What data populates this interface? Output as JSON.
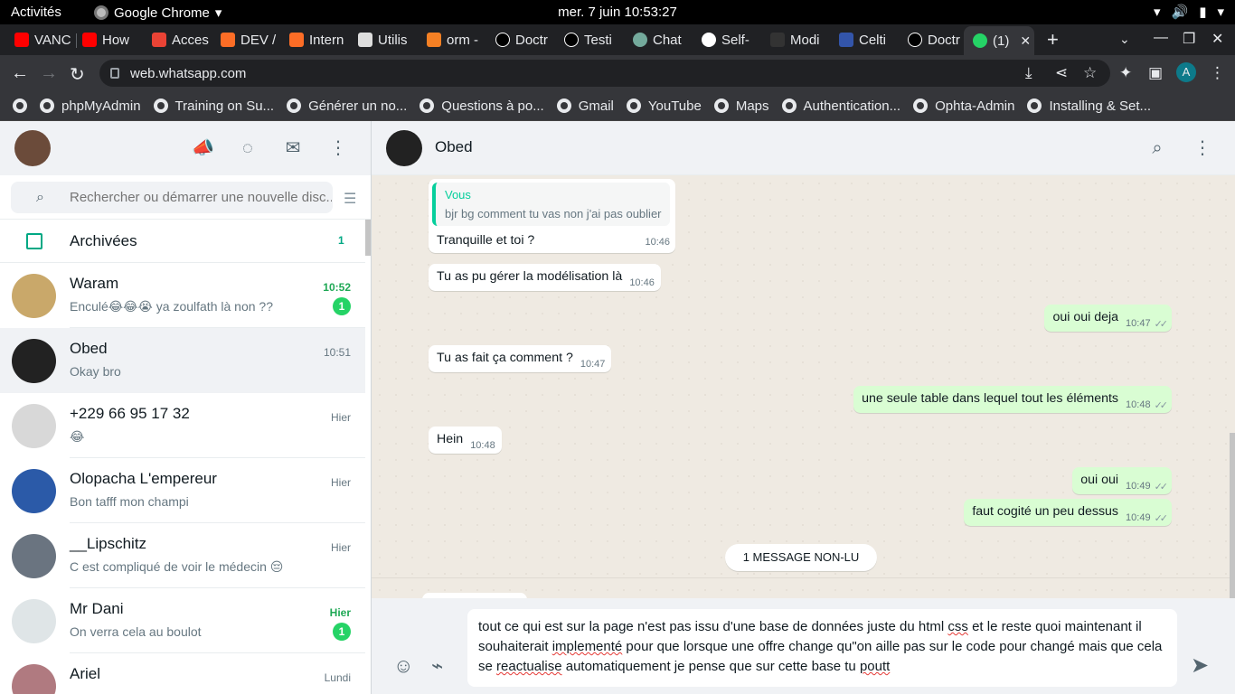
{
  "system": {
    "activities": "Activités",
    "app_name": "Google Chrome",
    "clock": "mer. 7 juin  10:53:27"
  },
  "tabs": [
    {
      "label": "VANC",
      "color": "#ff0000"
    },
    {
      "label": "How",
      "color": "#ff0000"
    },
    {
      "label": "Acces",
      "color": "#ea4335"
    },
    {
      "label": "DEV /",
      "color": "#fc6d26"
    },
    {
      "label": "Intern",
      "color": "#fc6d26"
    },
    {
      "label": "Utilis",
      "color": "#dddddd"
    },
    {
      "label": "orm -",
      "color": "#f48024"
    },
    {
      "label": "Doctr",
      "color": "#000000"
    },
    {
      "label": "Testi",
      "color": "#000000"
    },
    {
      "label": "Chat",
      "color": "#74aa9c"
    },
    {
      "label": "Self-",
      "color": "#ffffff"
    },
    {
      "label": "Modi",
      "color": "#333333"
    },
    {
      "label": "Celti",
      "color": "#3355aa"
    },
    {
      "label": "Doctr",
      "color": "#000000"
    },
    {
      "label": "(1)",
      "color": "#25d366"
    }
  ],
  "browser": {
    "url": "web.whatsapp.com",
    "profile_initial": "A"
  },
  "bookmarks": [
    "phpMyAdmin",
    "Training on Su...",
    "Générer un no...",
    "Questions à po...",
    "Gmail",
    "YouTube",
    "Maps",
    "Authentication...",
    "Ophta-Admin",
    "Installing & Set..."
  ],
  "sidebar": {
    "search_placeholder": "Rechercher ou démarrer une nouvelle disc...",
    "archived_label": "Archivées",
    "archived_count": "1",
    "chats": [
      {
        "name": "Waram",
        "time": "10:52",
        "preview": "Enculé😂😂😭 ya zoulfath là non ??",
        "badge": "1",
        "unread": true,
        "avatar": "#c9a86a"
      },
      {
        "name": "Obed",
        "time": "10:51",
        "preview": "Okay bro",
        "badge": "",
        "unread": false,
        "avatar": "#222222"
      },
      {
        "name": "+229 66 95 17 32",
        "time": "Hier",
        "preview": "😂",
        "badge": "",
        "unread": false,
        "avatar": "#d8d8d8"
      },
      {
        "name": "Olopacha L'empereur",
        "time": "Hier",
        "preview": "Bon tafff mon champi",
        "badge": "",
        "unread": false,
        "avatar": "#2b5aa8"
      },
      {
        "name": "__Lipschitz",
        "time": "Hier",
        "preview": "C est compliqué de voir le médecin 😔",
        "badge": "",
        "unread": false,
        "avatar": "#6a7480"
      },
      {
        "name": "Mr Dani",
        "time": "Hier",
        "preview": "On verra cela au boulot",
        "badge": "1",
        "unread": true,
        "avatar": "#dfe5e7"
      },
      {
        "name": "Ariel",
        "time": "Lundi",
        "preview": "",
        "badge": "",
        "unread": false,
        "avatar": "#b07a80"
      }
    ]
  },
  "conversation": {
    "contact_name": "Obed",
    "quote_author": "Vous",
    "quote_text": "bjr bg comment tu vas non j'ai pas oublier",
    "messages": [
      {
        "text": "Tranquille et toi ?",
        "time": "10:46"
      },
      {
        "text": "Tu as pu gérer la modélisation là",
        "time": "10:46"
      },
      {
        "text": "oui oui deja",
        "time": "10:47"
      },
      {
        "text": "Tu as fait ça comment ?",
        "time": "10:47"
      },
      {
        "text": "une seule table dans lequel tout les éléments",
        "time": "10:48"
      },
      {
        "text": "Hein",
        "time": "10:48"
      },
      {
        "text": "oui oui",
        "time": "10:49"
      },
      {
        "text": "faut cogité un peu dessus",
        "time": "10:49"
      }
    ],
    "unread_divider": "1 MESSAGE NON-LU",
    "composer": {
      "part1": "tout ce qui est sur la page n'est pas issu d'une base de données juste du html ",
      "w1": "css",
      "part2": " et le reste quoi maintenant il souhaiterait ",
      "w2": "implementé",
      "part3": " pour que lorsque une offre change qu\"on aille pas sur le code pour changé mais que cela se ",
      "w3": "reactualise",
      "part4": " automatiquement je pense que sur cette base tu ",
      "w4": "poutt"
    }
  }
}
